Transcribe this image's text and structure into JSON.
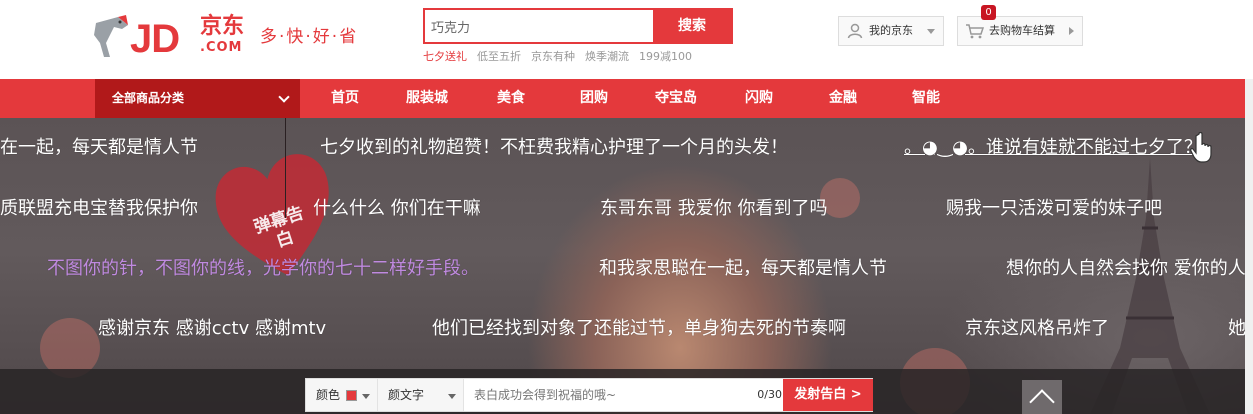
{
  "header": {
    "logo_text": "JD",
    "logo_cn": "京东",
    "logo_com": ".COM",
    "slogan": "多·快·好·省",
    "search": {
      "value": "巧克力",
      "button_label": "搜索"
    },
    "hotwords": [
      "七夕送礼",
      "低至五折",
      "京东有种",
      "焕季潮流",
      "199减100"
    ],
    "my_jd_label": "我的京东",
    "cart_label": "去购物车结算",
    "cart_count": "0"
  },
  "nav": {
    "category_label": "全部商品分类",
    "items": [
      "首页",
      "服装城",
      "美食",
      "团购",
      "夺宝岛",
      "闪购",
      "金融",
      "智能"
    ]
  },
  "banner": {
    "heart_text": "弹幕告白",
    "danmaku": [
      "在一起，每天都是情人节",
      "七夕收到的礼物超赞！不枉费我精心护理了一个月的头发！",
      "。◕‿◕。谁说有娃就不能过七夕了？",
      "质联盟充电宝替我保护你",
      "什么什么 你们在干嘛",
      "东哥东哥 我爱你 你看到了吗",
      "赐我一只活泼可爱的妹子吧",
      "不图你的针，不图你的线，光学你的七十二样好手段。",
      "和我家思聪在一起，每天都是情人节",
      "想你的人自然会找你 爱你的人会",
      "感谢京东 感谢cctv 感谢mtv",
      "他们已经找到对象了还能过节，单身狗去死的节奏啊",
      "京东这风格吊炸了",
      "她可"
    ]
  },
  "sendbar": {
    "color_label": "颜色",
    "emoji_label": "颜文字",
    "placeholder": "表白成功会得到祝福的哦~",
    "counter": "0/30",
    "send_label": "发射告白 >"
  },
  "colors": {
    "brand_red": "#e4393c",
    "nav_dark": "#b1191a",
    "purple_text": "#c08ae0"
  }
}
